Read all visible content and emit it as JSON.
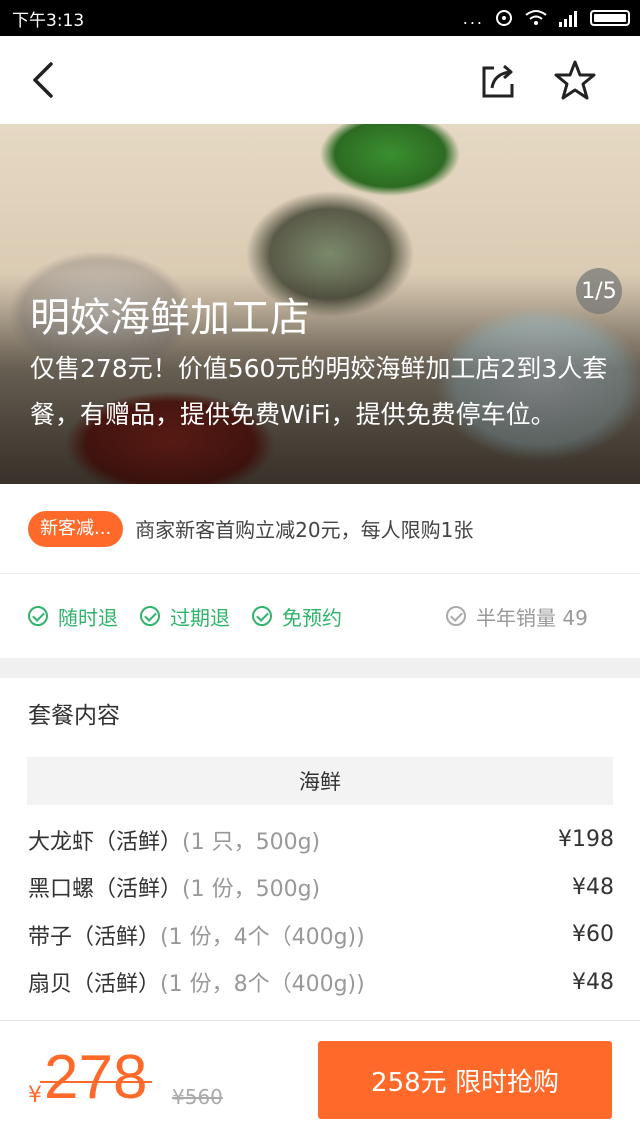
{
  "status_bar": {
    "time": "下午3:13",
    "dots": "..."
  },
  "nav": {
    "back_icon": "back-arrow-icon",
    "share_icon": "share-icon",
    "favorite_icon": "star-icon"
  },
  "hero": {
    "page_indicator": "1/5",
    "shop_name": "明姣海鲜加工店",
    "description": "仅售278元！价值560元的明姣海鲜加工店2到3人套餐，有赠品，提供免费WiFi，提供免费停车位。"
  },
  "promo": {
    "badge": "新客减...",
    "text": "商家新客首购立减20元，每人限购1张"
  },
  "guarantees": {
    "items": [
      "随时退",
      "过期退",
      "免预约"
    ],
    "sales": "半年销量 49"
  },
  "package": {
    "title": "套餐内容",
    "category": "海鲜",
    "items": [
      {
        "name": "大龙虾（活鲜）",
        "spec": "(1 只，500g)",
        "price": "¥198"
      },
      {
        "name": "黑口螺（活鲜）",
        "spec": "(1 份，500g)",
        "price": "¥48"
      },
      {
        "name": "带子（活鲜）",
        "spec": "(1 份，4个（400g))",
        "price": "¥60"
      },
      {
        "name": "扇贝（活鲜）",
        "spec": "(1 份，8个（400g))",
        "price": "¥48"
      }
    ]
  },
  "bottom": {
    "currency": "¥",
    "price": "278",
    "original_price": "¥560",
    "buy_label": "258元 限时抢购"
  },
  "colors": {
    "accent": "#ff6a2b",
    "green": "#2fb56a"
  }
}
